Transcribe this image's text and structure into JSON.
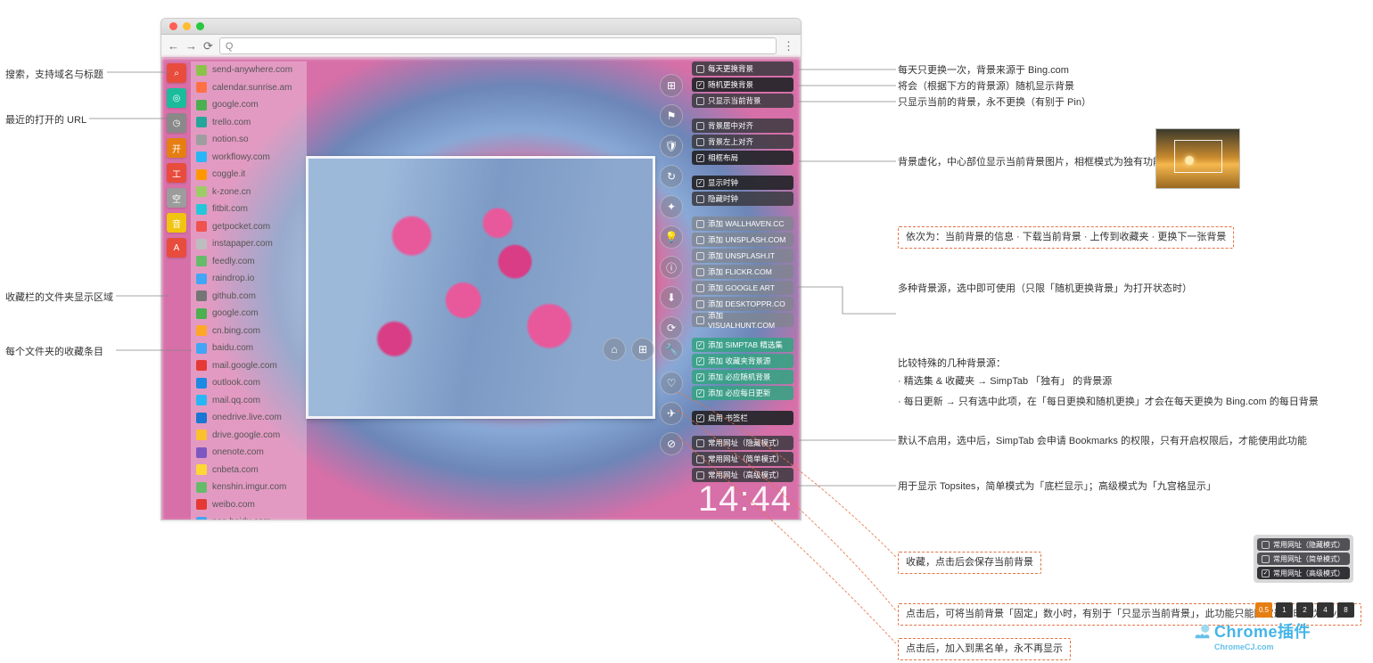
{
  "browser": {
    "addr_prefix": "Q"
  },
  "clock": "14:44",
  "rail": [
    {
      "glyph": "⌕",
      "name": "search-icon"
    },
    {
      "glyph": "◎",
      "name": "target-icon"
    },
    {
      "glyph": "◷",
      "name": "history-icon"
    },
    {
      "glyph": "开",
      "name": "open-icon"
    },
    {
      "glyph": "工",
      "name": "tools-icon"
    },
    {
      "glyph": "空",
      "name": "blank-icon"
    },
    {
      "glyph": "音",
      "name": "audio-icon"
    },
    {
      "glyph": "A",
      "name": "letter-a-icon"
    }
  ],
  "bookmarks": [
    {
      "label": "send-anywhere.com",
      "c": "#8bc34a"
    },
    {
      "label": "calendar.sunrise.am",
      "c": "#ff7043"
    },
    {
      "label": "google.com",
      "c": "#4caf50"
    },
    {
      "label": "trello.com",
      "c": "#26a69a"
    },
    {
      "label": "notion.so",
      "c": "#9e9e9e"
    },
    {
      "label": "workflowy.com",
      "c": "#29b6f6"
    },
    {
      "label": "coggle.it",
      "c": "#ff9800"
    },
    {
      "label": "k-zone.cn",
      "c": "#9ccc65"
    },
    {
      "label": "fitbit.com",
      "c": "#26c6da"
    },
    {
      "label": "getpocket.com",
      "c": "#ef5350"
    },
    {
      "label": "instapaper.com",
      "c": "#bdbdbd"
    },
    {
      "label": "feedly.com",
      "c": "#66bb6a"
    },
    {
      "label": "raindrop.io",
      "c": "#42a5f5"
    },
    {
      "label": "github.com",
      "c": "#757575"
    },
    {
      "label": "google.com",
      "c": "#4caf50"
    },
    {
      "label": "cn.bing.com",
      "c": "#ffa726"
    },
    {
      "label": "baidu.com",
      "c": "#42a5f5"
    },
    {
      "label": "mail.google.com",
      "c": "#e53935"
    },
    {
      "label": "outlook.com",
      "c": "#1e88e5"
    },
    {
      "label": "mail.qq.com",
      "c": "#29b6f6"
    },
    {
      "label": "onedrive.live.com",
      "c": "#1976d2"
    },
    {
      "label": "drive.google.com",
      "c": "#fbc02d"
    },
    {
      "label": "onenote.com",
      "c": "#7e57c2"
    },
    {
      "label": "cnbeta.com",
      "c": "#fdd835"
    },
    {
      "label": "kenshin.imgur.com",
      "c": "#66bb6a"
    },
    {
      "label": "weibo.com",
      "c": "#e53935"
    },
    {
      "label": "pan.baidu.com",
      "c": "#42a5f5"
    }
  ],
  "icons_top": [
    {
      "g": "⊞",
      "n": "grid-icon"
    },
    {
      "g": "⚑",
      "n": "bookmark-icon"
    },
    {
      "g": "🛡",
      "n": "shield-icon"
    },
    {
      "g": "↻",
      "n": "reload-icon"
    },
    {
      "g": "✦",
      "n": "star-icon"
    },
    {
      "g": "💡",
      "n": "bulb-icon"
    },
    {
      "g": "ⓘ",
      "n": "info-icon"
    },
    {
      "g": "⬇",
      "n": "download-icon"
    },
    {
      "g": "⟳",
      "n": "refresh-icon"
    }
  ],
  "icons_row": [
    {
      "g": "⌂",
      "n": "home-icon"
    },
    {
      "g": "⊞",
      "n": "apps-icon"
    },
    {
      "g": "🔧",
      "n": "wrench-icon"
    }
  ],
  "icons_bot": [
    {
      "g": "♡",
      "n": "heart-icon"
    },
    {
      "g": "✈",
      "n": "pin-icon"
    },
    {
      "g": "⊘",
      "n": "block-icon"
    }
  ],
  "settings": [
    {
      "t": "每天更换背景",
      "c": "o-dark",
      "on": false
    },
    {
      "t": "随机更换背景",
      "c": "o-darksel",
      "on": true
    },
    {
      "t": "只显示当前背景",
      "c": "o-dark",
      "on": false
    },
    {
      "gap": true
    },
    {
      "t": "背景居中对齐",
      "c": "o-dark",
      "on": false
    },
    {
      "t": "背景左上对齐",
      "c": "o-dark",
      "on": false
    },
    {
      "t": "相框布局",
      "c": "o-darksel",
      "on": true
    },
    {
      "gap": true
    },
    {
      "t": "显示时钟",
      "c": "o-darksel",
      "on": true
    },
    {
      "t": "隐藏时钟",
      "c": "o-dark",
      "on": false
    },
    {
      "gap": true
    },
    {
      "t": "添加 WALLHAVEN.CC",
      "c": "o-grey",
      "on": false
    },
    {
      "t": "添加 UNSPLASH.COM",
      "c": "o-grey",
      "on": false
    },
    {
      "t": "添加 UNSPLASH.IT",
      "c": "o-grey",
      "on": false
    },
    {
      "t": "添加 FLICKR.COM",
      "c": "o-grey",
      "on": false
    },
    {
      "t": "添加 GOOGLE ART",
      "c": "o-grey",
      "on": false
    },
    {
      "t": "添加 DESKTOPPR.CO",
      "c": "o-grey",
      "on": false
    },
    {
      "t": "添加 VISUALHUNT.COM",
      "c": "o-grey",
      "on": false
    },
    {
      "gap": true
    },
    {
      "t": "添加 SIMPTAB 精选集",
      "c": "o-teal",
      "on": true
    },
    {
      "t": "添加 收藏夹背景源",
      "c": "o-teal",
      "on": true
    },
    {
      "t": "添加 必应随机背景",
      "c": "o-teal",
      "on": true
    },
    {
      "t": "添加 必应每日更新",
      "c": "o-teal",
      "on": true
    },
    {
      "gap": true
    },
    {
      "t": "启用 书签栏",
      "c": "o-darksel",
      "on": true
    },
    {
      "gap": true
    },
    {
      "t": "常用网址（隐藏模式）",
      "c": "o-dark",
      "on": false
    },
    {
      "t": "常用网址（简单模式）",
      "c": "o-dark",
      "on": false
    },
    {
      "t": "常用网址（高级模式）",
      "c": "o-dark",
      "on": false
    }
  ],
  "mini": [
    {
      "t": "常用网址（隐藏模式）",
      "on": false
    },
    {
      "t": "常用网址（简单模式）",
      "on": false
    },
    {
      "t": "常用网址（高级模式）",
      "on": true
    }
  ],
  "topsites": [
    "0.5",
    "1",
    "2",
    "4",
    "8"
  ],
  "callouts": {
    "l1": "搜索，支持域名与标题",
    "l2": "最近的打开的 URL",
    "l3": "收藏栏的文件夹显示区域",
    "l4": "每个文件夹的收藏条目",
    "r1": "每天只更换一次，背景来源于 Bing.com",
    "r2": "将会（根据下方的背景源）随机显示背景",
    "r3": "只显示当前的背景，永不更换（有别于 Pin）",
    "r4": "背景虚化，中心部位显示当前背景图片，相框模式为独有功能，效果如右图 →",
    "r5": "依次为：当前背景的信息 · 下载当前背景 · 上传到收藏夹 · 更换下一张背景",
    "r6": "多种背景源，选中即可使用（只限「随机更换背景」为打开状态时）",
    "r7a": "比较特殊的几种背景源：",
    "r7b": "· 精选集 & 收藏夹 → SimpTab 「独有」 的背景源",
    "r7c": "· 每日更新 →  只有选中此项，在「每日更换和随机更换」才会在每天更换为 Bing.com 的每日背景",
    "r8": "默认不启用，选中后，SimpTab 会申请 Bookmarks 的权限，只有开启权限后，才能使用此功能",
    "r9": "用于显示 Topsites，简单模式为「底栏显示」；高级模式为「九宫格显示」",
    "r10": "收藏，点击后会保存当前背景",
    "r11": "点击后，可将当前背景「固定」数小时，有别于「只显示当前背景」，此功能只能固定最大时间为 8 小时",
    "r12": "点击后，加入到黑名单，永不再显示"
  },
  "watermark": {
    "main": "Chrome插件",
    "sub": "ChromeCJ.com"
  }
}
